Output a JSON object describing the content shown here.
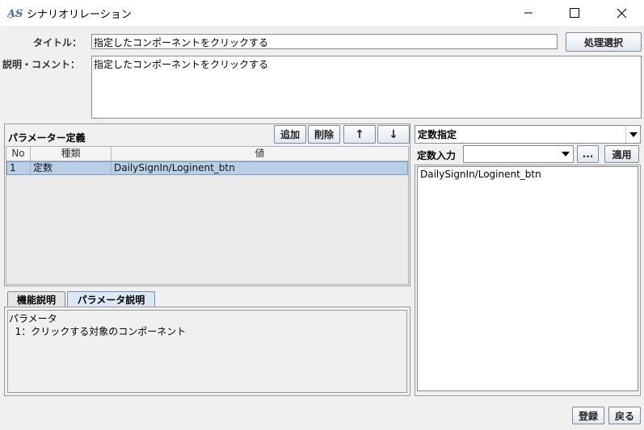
{
  "window": {
    "title": "シナリオリレーション",
    "minimize_glyph": "—",
    "maximize_glyph": "□",
    "close_glyph": "✕"
  },
  "form": {
    "title_label": "タイトル：",
    "title_value": "指定したコンポーネントをクリックする",
    "process_select_label": "処理選択",
    "comment_label": "説明・コメント：",
    "comment_value": "指定したコンポーネントをクリックする"
  },
  "params": {
    "section_title": "パラメーター定義",
    "add_label": "追加",
    "delete_label": "削除",
    "up_label": "↑",
    "down_label": "↓",
    "columns": [
      "No",
      "種類",
      "値"
    ],
    "rows": [
      {
        "no": "1",
        "kind": "定数",
        "value": "DailySignIn/Loginent_btn"
      }
    ]
  },
  "tabs": [
    {
      "label": "機能説明",
      "active": false
    },
    {
      "label": "パラメータ説明",
      "active": true
    }
  ],
  "description": {
    "line1": "パラメータ",
    "line2": "  1：クリックする対象のコンポーネント"
  },
  "constant": {
    "mode_value": "定数指定",
    "input_label": "定数入力",
    "input_value": "",
    "ellipsis_label": "...",
    "apply_label": "適用",
    "text_value": "DailySignIn/Loginent_btn"
  },
  "footer": {
    "register_label": "登録",
    "back_label": "戻る"
  },
  "colors": {
    "selection": "#b8cfe5",
    "background": "#f0f0f0",
    "active_tab": "#dce8f6"
  }
}
